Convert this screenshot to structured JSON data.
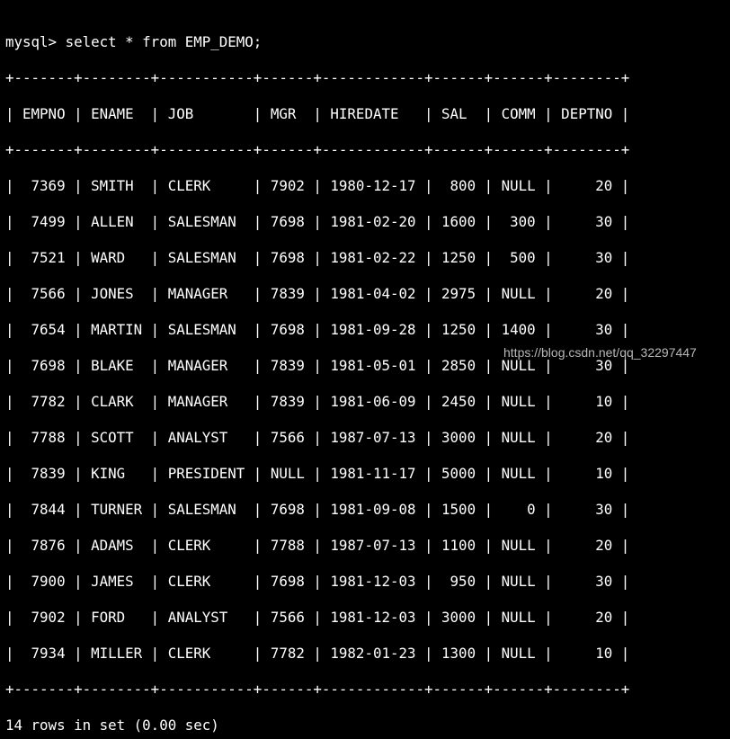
{
  "terminal": {
    "prompt": "mysql> select * from EMP_DEMO;",
    "separator": "+-------+--------+-----------+------+------------+------+------+--------+",
    "header": "| EMPNO | ENAME  | JOB       | MGR  | HIREDATE   | SAL  | COMM | DEPTNO |",
    "rows": [
      "|  7369 | SMITH  | CLERK     | 7902 | 1980-12-17 |  800 | NULL |     20 |",
      "|  7499 | ALLEN  | SALESMAN  | 7698 | 1981-02-20 | 1600 |  300 |     30 |",
      "|  7521 | WARD   | SALESMAN  | 7698 | 1981-02-22 | 1250 |  500 |     30 |",
      "|  7566 | JONES  | MANAGER   | 7839 | 1981-04-02 | 2975 | NULL |     20 |",
      "|  7654 | MARTIN | SALESMAN  | 7698 | 1981-09-28 | 1250 | 1400 |     30 |",
      "|  7698 | BLAKE  | MANAGER   | 7839 | 1981-05-01 | 2850 | NULL |     30 |",
      "|  7782 | CLARK  | MANAGER   | 7839 | 1981-06-09 | 2450 | NULL |     10 |",
      "|  7788 | SCOTT  | ANALYST   | 7566 | 1987-07-13 | 3000 | NULL |     20 |",
      "|  7839 | KING   | PRESIDENT | NULL | 1981-11-17 | 5000 | NULL |     10 |",
      "|  7844 | TURNER | SALESMAN  | 7698 | 1981-09-08 | 1500 |    0 |     30 |",
      "|  7876 | ADAMS  | CLERK     | 7788 | 1987-07-13 | 1100 | NULL |     20 |",
      "|  7900 | JAMES  | CLERK     | 7698 | 1981-12-03 |  950 | NULL |     30 |",
      "|  7902 | FORD   | ANALYST   | 7566 | 1981-12-03 | 3000 | NULL |     20 |",
      "|  7934 | MILLER | CLERK     | 7782 | 1982-01-23 | 1300 | NULL |     10 |"
    ],
    "footer": "14 rows in set (0.00 sec)"
  },
  "watermark": "https://blog.csdn.net/qq_32297447",
  "colors": {
    "background": "#000000",
    "text": "#ffffff",
    "watermark": "#b8b8b8"
  }
}
